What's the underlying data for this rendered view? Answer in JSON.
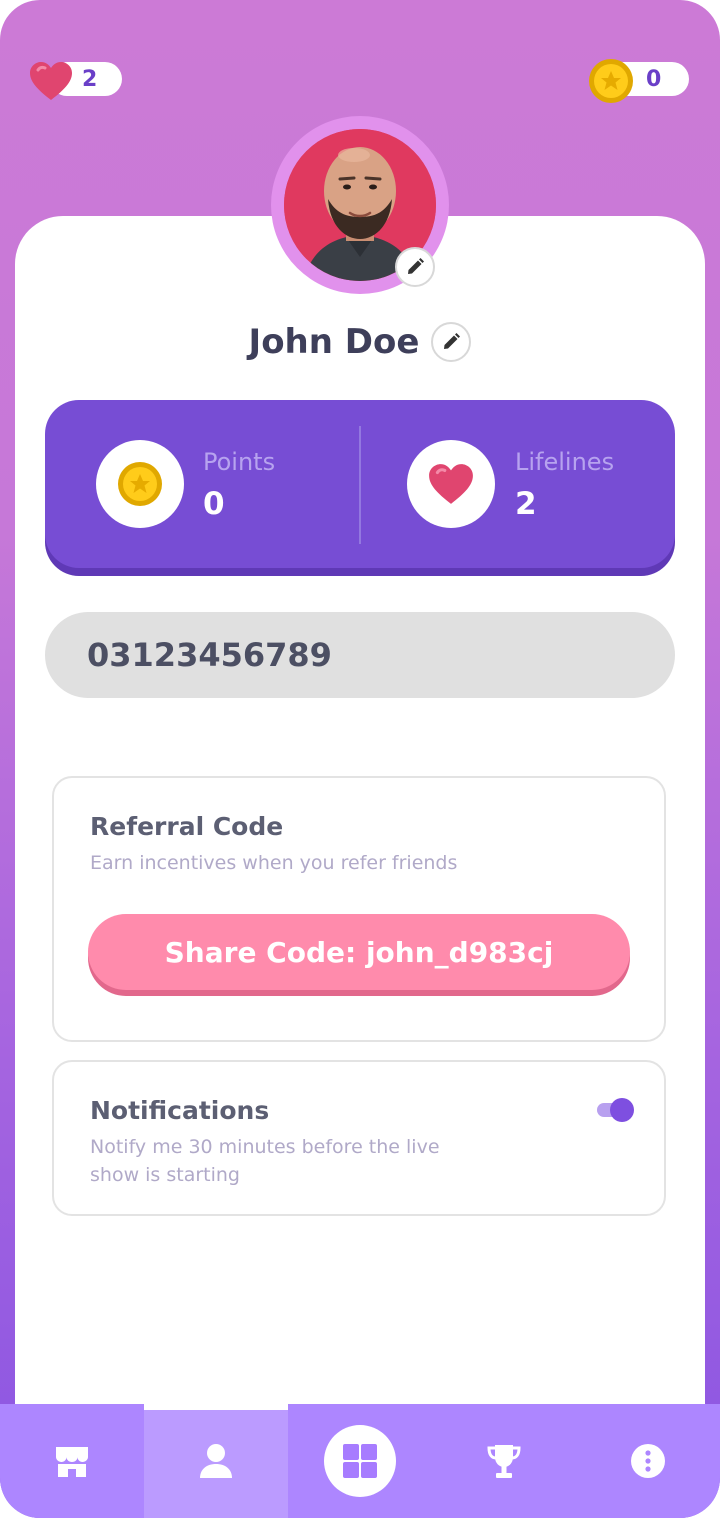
{
  "topbar": {
    "lifelines_count": "2",
    "points_count": "0"
  },
  "profile": {
    "name": "John Doe"
  },
  "stats": {
    "points_label": "Points",
    "points_value": "0",
    "lifelines_label": "Lifelines",
    "lifelines_value": "2"
  },
  "phone": {
    "value": "03123456789"
  },
  "referral": {
    "title": "Referral Code",
    "subtitle": "Earn incentives when you refer friends",
    "button_label": "Share Code: john_d983cj"
  },
  "notifications": {
    "title": "Notifications",
    "subtitle_line1": "Notify me 30 minutes before the live",
    "subtitle_line2": "show is starting",
    "enabled": true
  },
  "nav": {
    "items": [
      {
        "icon": "store-icon"
      },
      {
        "icon": "user-icon",
        "active": true
      },
      {
        "icon": "grid-icon"
      },
      {
        "icon": "trophy-icon"
      },
      {
        "icon": "more-icon"
      }
    ]
  },
  "colors": {
    "accent": "#774dd4",
    "share_button": "#ff8bac",
    "nav_bg": "#ad86ff"
  }
}
